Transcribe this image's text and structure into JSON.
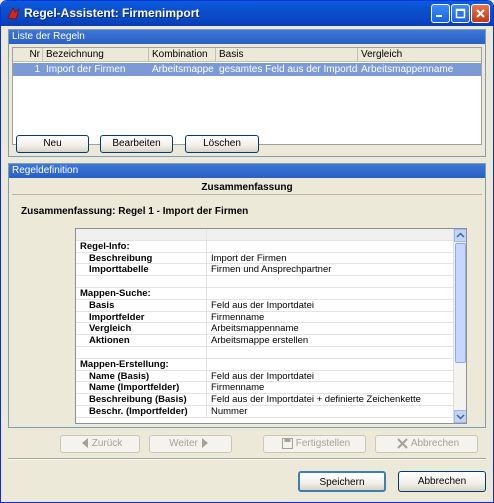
{
  "window": {
    "title": "Regel-Assistent: Firmenimport"
  },
  "rules_panel": {
    "header": "Liste der Regeln",
    "columns": [
      "Nr",
      "Bezeichnung",
      "Kombination",
      "Basis",
      "Vergleich"
    ],
    "rows": [
      {
        "nr": "1",
        "bezeichnung": "Import der Firmen",
        "kombination": "Arbeitsmappe erstellen",
        "basis": "gesamtes Feld aus der Importdatei",
        "vergleich": "Arbeitsmappenname"
      }
    ],
    "buttons": {
      "new": "Neu",
      "edit": "Bearbeiten",
      "delete": "Löschen"
    }
  },
  "definition_panel": {
    "header": "Regeldefinition",
    "summary_title": "Zusammenfassung",
    "summary_subtitle": "Zusammenfassung: Regel 1 - Import der Firmen",
    "grid_rows": [
      {
        "key": "",
        "value": "",
        "type": "header"
      },
      {
        "key": "Regel-Info:",
        "value": "",
        "type": "section"
      },
      {
        "key": "Beschreibung",
        "value": "Import der Firmen",
        "type": "item"
      },
      {
        "key": "Importtabelle",
        "value": "Firmen und Ansprechpartner",
        "type": "item"
      },
      {
        "key": "",
        "value": "",
        "type": "blank"
      },
      {
        "key": "Mappen-Suche:",
        "value": "",
        "type": "section"
      },
      {
        "key": "Basis",
        "value": "Feld aus der Importdatei",
        "type": "item"
      },
      {
        "key": "Importfelder",
        "value": "Firmenname",
        "type": "item"
      },
      {
        "key": "Vergleich",
        "value": "Arbeitsmappenname",
        "type": "item"
      },
      {
        "key": "Aktionen",
        "value": "Arbeitsmappe erstellen",
        "type": "item"
      },
      {
        "key": "",
        "value": "",
        "type": "blank"
      },
      {
        "key": "Mappen-Erstellung:",
        "value": "",
        "type": "section"
      },
      {
        "key": "Name (Basis)",
        "value": "Feld aus der Importdatei",
        "type": "item"
      },
      {
        "key": "Name (Importfelder)",
        "value": "Firmenname",
        "type": "item"
      },
      {
        "key": "Beschreibung (Basis)",
        "value": "Feld aus der Importdatei + definierte Zeichenkette",
        "type": "item"
      },
      {
        "key": "Beschr. (Importfelder)",
        "value": "Nummer",
        "type": "item"
      }
    ]
  },
  "wizard_buttons": {
    "back": "Zurück",
    "next": "Weiter",
    "finish": "Fertigstellen",
    "cancel_wizard": "Abbrechen"
  },
  "dialog_buttons": {
    "save": "Speichern",
    "cancel": "Abbrechen"
  }
}
